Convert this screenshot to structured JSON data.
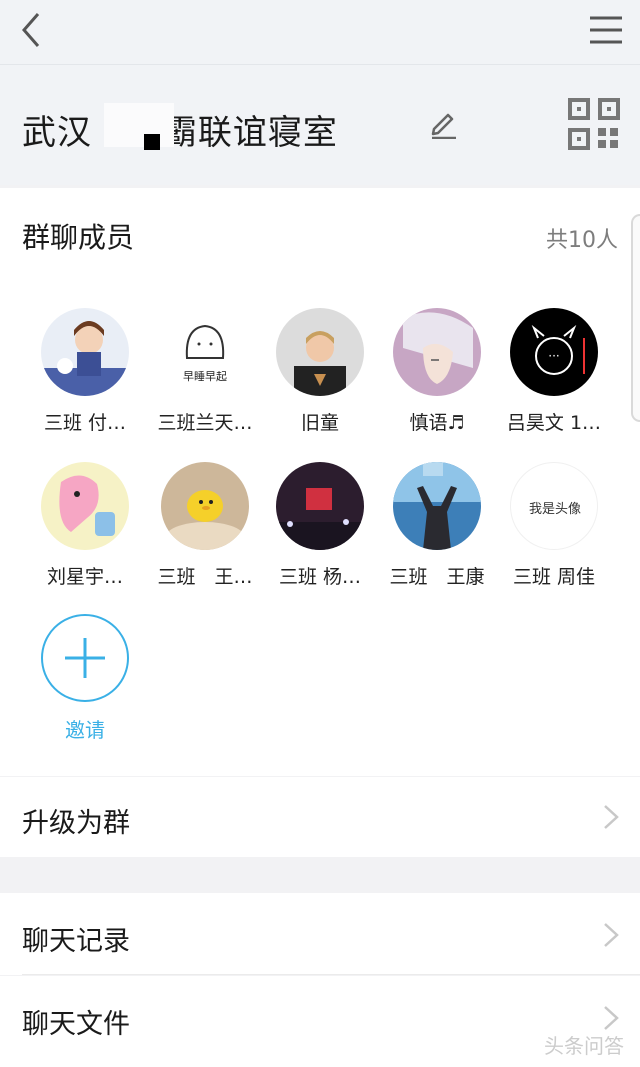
{
  "header": {
    "title": "武汉  ▪制霸联谊寝室"
  },
  "members": {
    "section_title": "群聊成员",
    "count_label": "共10人",
    "list": [
      {
        "name": "三班 付…",
        "avatar_color": "#e9eef6"
      },
      {
        "name": "三班兰天…",
        "avatar_color": "#ffffff",
        "avatar_text": "早睡早起"
      },
      {
        "name": "旧童",
        "avatar_color": "#dcdcdc"
      },
      {
        "name": "慎语♬",
        "avatar_color": "#c7a6c4"
      },
      {
        "name": "吕昊文 1…",
        "avatar_color": "#000000",
        "avatar_text": "···"
      },
      {
        "name": "刘星宇…",
        "avatar_color": "#ffd6e6"
      },
      {
        "name": "三班　王…",
        "avatar_color": "#cdb79a"
      },
      {
        "name": "三班 杨…",
        "avatar_color": "#2c1d2e"
      },
      {
        "name": "三班　王康",
        "avatar_color": "#3d7fb8"
      },
      {
        "name": "三班 周佳",
        "avatar_color": "#ffffff",
        "avatar_text": "我是头像"
      }
    ],
    "invite_label": "邀请"
  },
  "rows": {
    "upgrade": "升级为群",
    "chat_history": "聊天记录",
    "chat_files": "聊天文件"
  },
  "watermark": "头条问答",
  "colors": {
    "accent": "#3ab0e6",
    "chevron": "#c8c8c8"
  }
}
